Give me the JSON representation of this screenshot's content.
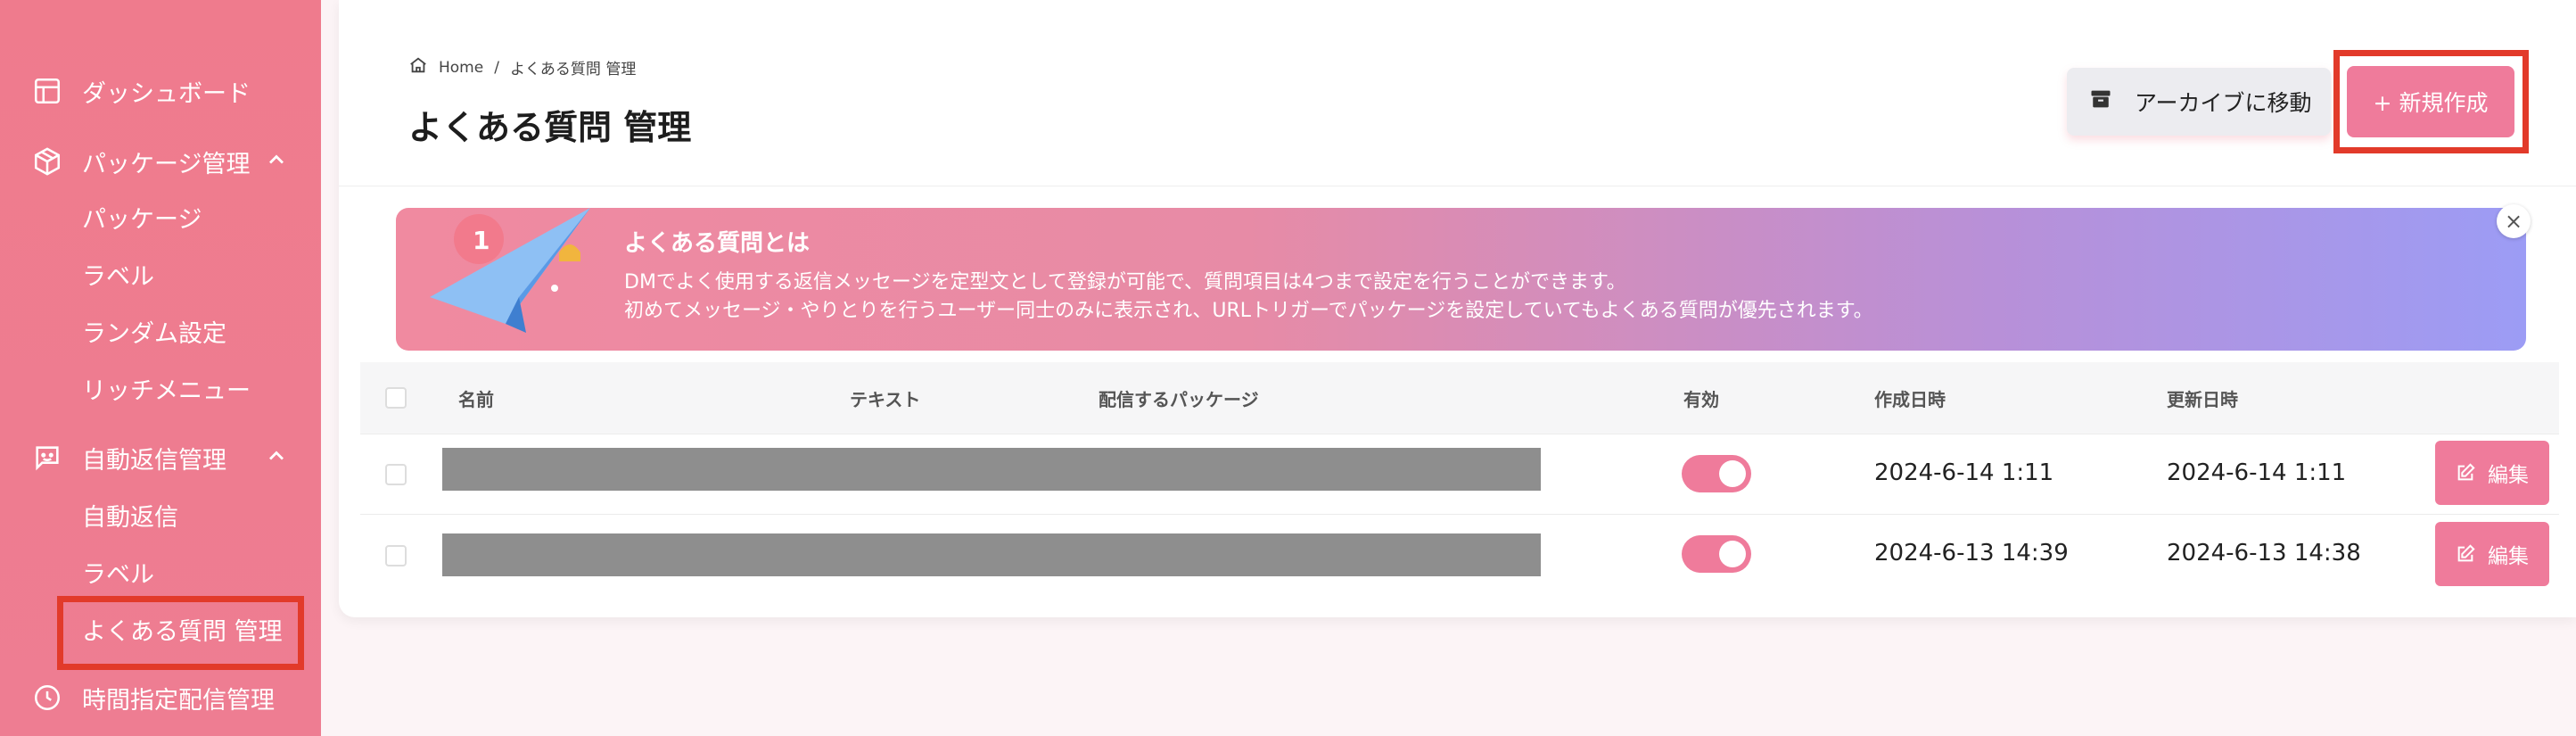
{
  "sidebar": {
    "dashboard": "ダッシュボード",
    "package_mgmt": "パッケージ管理",
    "package_sub": [
      "パッケージ",
      "ラベル",
      "ランダム設定",
      "リッチメニュー"
    ],
    "auto_reply_mgmt": "自動返信管理",
    "auto_reply_sub": [
      "自動返信",
      "ラベル",
      "よくある質問 管理"
    ],
    "scheduled_mgmt": "時間指定配信管理"
  },
  "breadcrumb": {
    "home": "Home",
    "sep": "/",
    "current": "よくある質問 管理"
  },
  "page_title": "よくある質問 管理",
  "buttons": {
    "archive": "アーカイブに移動",
    "new": "+ 新規作成",
    "edit": "編集"
  },
  "banner": {
    "badge": "1",
    "title": "よくある質問とは",
    "line1": "DMでよく使用する返信メッセージを定型文として登録が可能で、質問項目は4つまで設定を行うことができます。",
    "line2": "初めてメッセージ・やりとりを行うユーザー同士のみに表示され、URLトリガーでパッケージを設定していてもよくある質問が優先されます。",
    "close": "×"
  },
  "table": {
    "headers": {
      "name": "名前",
      "text": "テキスト",
      "package": "配信するパッケージ",
      "active": "有効",
      "created": "作成日時",
      "updated": "更新日時"
    },
    "rows": [
      {
        "active": true,
        "created": "2024-6-14 1:11",
        "updated": "2024-6-14 1:11"
      },
      {
        "active": true,
        "created": "2024-6-13 14:39",
        "updated": "2024-6-13 14:38"
      }
    ]
  },
  "colors": {
    "accent": "#ef7b9b",
    "sidebar": "#ef7b8d",
    "highlight": "#e23a2a"
  }
}
